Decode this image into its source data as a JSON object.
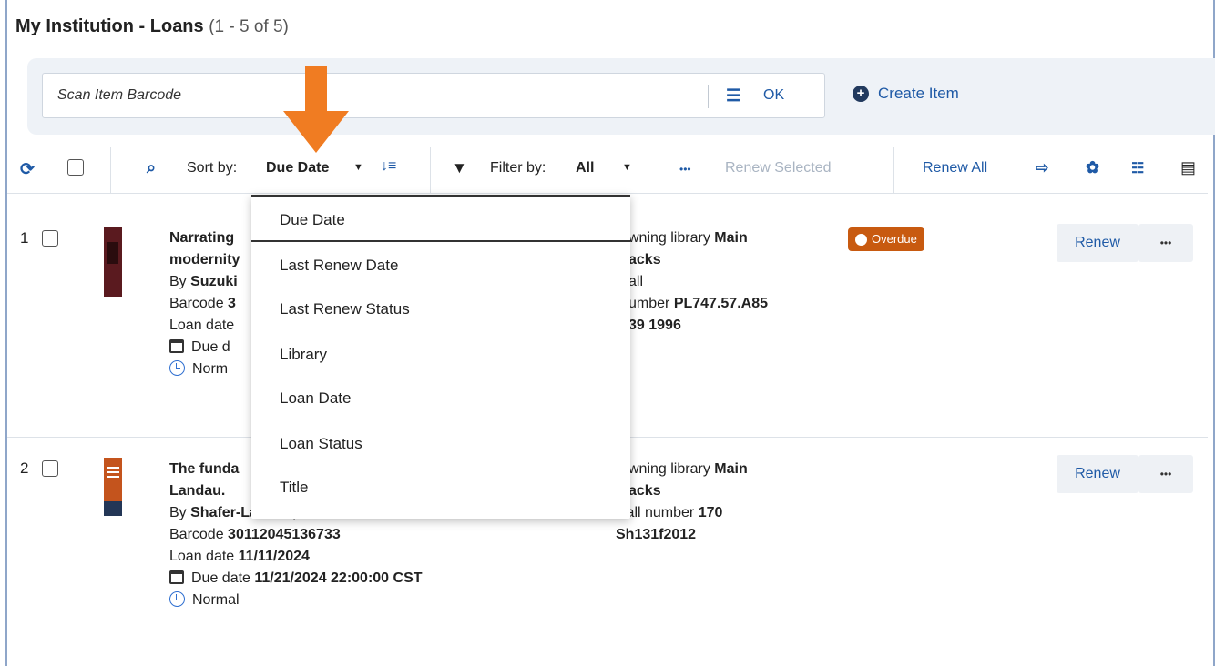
{
  "header": {
    "title": "My Institution - Loans",
    "count": "(1 - 5 of 5)"
  },
  "scan": {
    "placeholder": "Scan Item Barcode",
    "list_icon": "list-icon",
    "ok_label": "OK",
    "create_label": "Create Item"
  },
  "toolbar": {
    "refresh_icon": "refresh-icon",
    "sort_label": "Sort by:",
    "sort_value": "Due Date",
    "filter_label": "Filter by:",
    "filter_value": "All",
    "more": "•••",
    "renew_selected": "Renew Selected",
    "renew_all": "Renew All",
    "export_icon": "export-icon",
    "settings_icon": "settings-icon",
    "list_view_icon": "list-view-icon",
    "columns_icon": "columns-icon"
  },
  "sort_menu": {
    "items": [
      "Due Date",
      "Last Renew Date",
      "Last Renew Status",
      "Library",
      "Loan Date",
      "Loan Status",
      "Title"
    ],
    "selected": "Due Date"
  },
  "loans": [
    {
      "num": "1",
      "title_line1": "Narrating",
      "title_line2": "modernity",
      "by_label": "By",
      "author": "Suzuki",
      "barcode_label": "Barcode",
      "barcode": "3",
      "loan_date_label": "Loan date",
      "due_label": "Due d",
      "status": "Norm",
      "owning_label": "wning library",
      "owning_value": "Main",
      "stacks": "acks",
      "call_line1": "all",
      "call_line2_label": "umber",
      "call_line2_value": "PL747.57.A85",
      "call_line3": "39 1996",
      "badge": "Overdue",
      "renew": "Renew",
      "more": "•••"
    },
    {
      "num": "2",
      "title_line1": "The funda",
      "title_line2": "Landau.",
      "by_label": "By",
      "author": "Shafer-Landau, Russ.",
      "barcode_label": "Barcode",
      "barcode": "30112045136733",
      "loan_date_label": "Loan date",
      "loan_date": "11/11/2024",
      "due_label": "Due date",
      "due_date": "11/21/2024 22:00:00 CST",
      "status": "Normal",
      "owning_label": "wning library",
      "owning_value": "Main",
      "stacks": "acks",
      "call_label": "Call number",
      "call_value": "170",
      "call_line2": "Sh131f2012",
      "renew": "Renew",
      "more": "•••"
    }
  ],
  "colors": {
    "accent": "#1f5aa6",
    "overdue": "#c85a10",
    "arrow": "#f07c22",
    "panel": "#eef2f7"
  }
}
